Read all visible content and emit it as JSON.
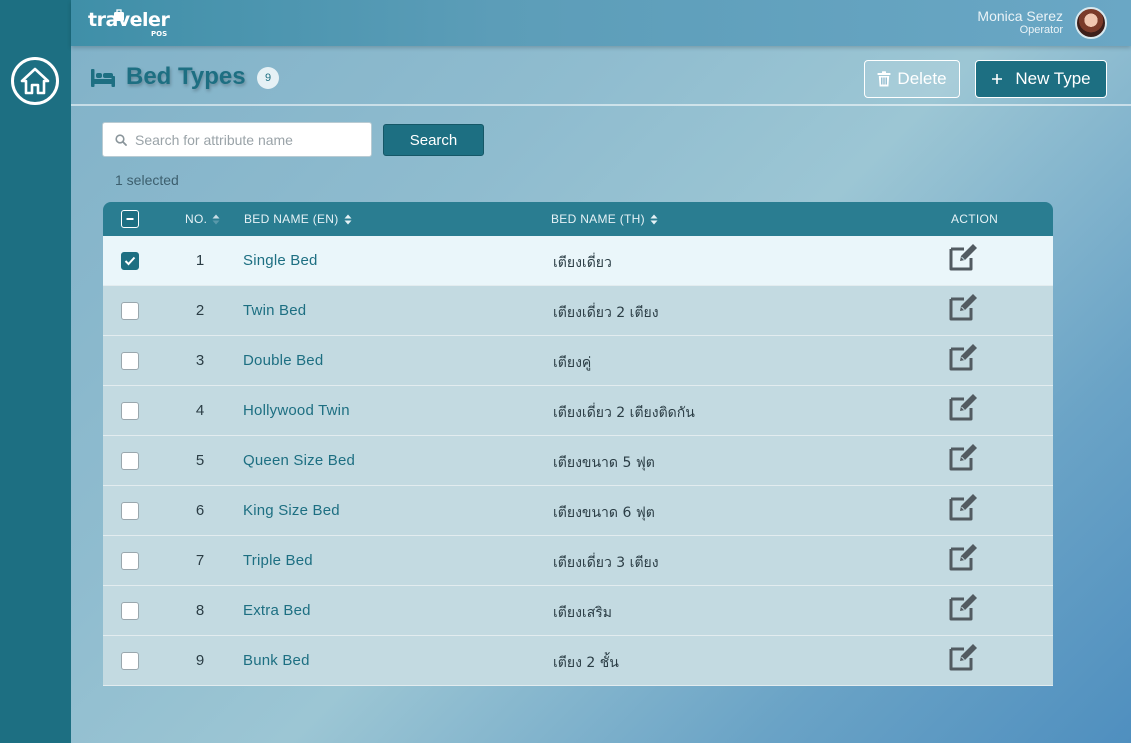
{
  "app": {
    "logo_text": "traveler",
    "logo_sub": "POS"
  },
  "user": {
    "name": "Monica Serez",
    "role": "Operator"
  },
  "header": {
    "title": "Bed Types",
    "count": "9",
    "delete_label": "Delete",
    "new_label": "New Type"
  },
  "search": {
    "placeholder": "Search for attribute name",
    "value": "",
    "button_label": "Search"
  },
  "selection_text": "1 selected",
  "table": {
    "columns": {
      "no": "NO.",
      "en": "BED NAME (EN)",
      "th": "BED NAME (TH)",
      "action": "ACTION"
    },
    "rows": [
      {
        "no": "1",
        "en": "Single Bed",
        "th": "เตียงเดี่ยว",
        "checked": true
      },
      {
        "no": "2",
        "en": "Twin Bed",
        "th": "เตียงเดี่ยว 2 เตียง",
        "checked": false
      },
      {
        "no": "3",
        "en": "Double Bed",
        "th": "เตียงคู่",
        "checked": false
      },
      {
        "no": "4",
        "en": "Hollywood Twin",
        "th": "เตียงเดี่ยว 2 เตียงติดกัน",
        "checked": false
      },
      {
        "no": "5",
        "en": "Queen Size Bed",
        "th": "เตียงขนาด 5 ฟุต",
        "checked": false
      },
      {
        "no": "6",
        "en": "King Size Bed",
        "th": "เตียงขนาด 6 ฟุต",
        "checked": false
      },
      {
        "no": "7",
        "en": "Triple Bed",
        "th": "เตียงเดี่ยว 3 เตียง",
        "checked": false
      },
      {
        "no": "8",
        "en": "Extra Bed",
        "th": "เตียงเสริม",
        "checked": false
      },
      {
        "no": "9",
        "en": "Bunk Bed",
        "th": "เตียง 2 ชั้น",
        "checked": false
      }
    ]
  },
  "colors": {
    "primary": "#1d6f82",
    "header_row": "#2a7d91",
    "row_bg": "#c3dae1",
    "selected_row_bg": "#eaf6fa"
  }
}
